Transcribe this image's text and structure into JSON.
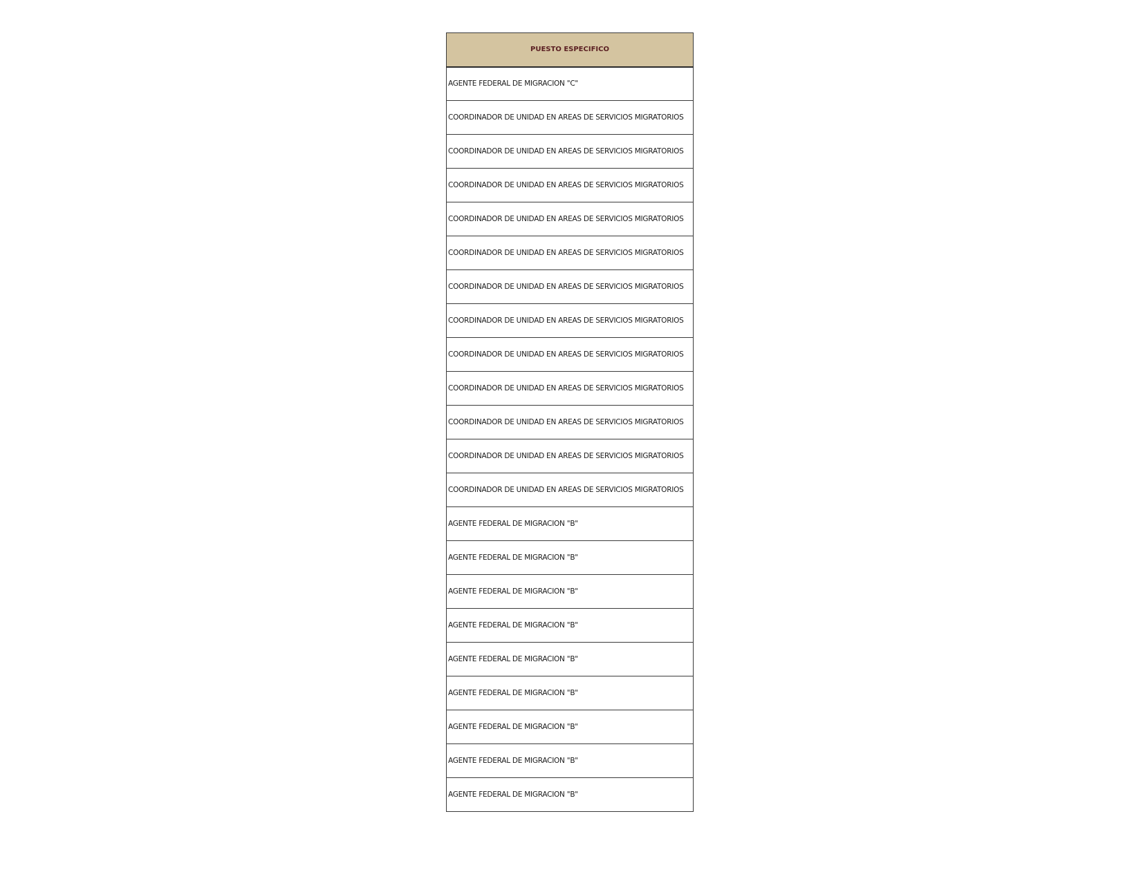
{
  "table": {
    "header": "PUESTO ESPECIFICO",
    "rows": [
      "AGENTE FEDERAL DE MIGRACION \"C\"",
      "COORDINADOR DE UNIDAD EN AREAS DE SERVICIOS MIGRATORIOS",
      "COORDINADOR DE UNIDAD EN AREAS DE SERVICIOS MIGRATORIOS",
      "COORDINADOR DE UNIDAD EN AREAS DE SERVICIOS MIGRATORIOS",
      "COORDINADOR DE UNIDAD EN AREAS DE SERVICIOS MIGRATORIOS",
      "COORDINADOR DE UNIDAD EN AREAS DE SERVICIOS MIGRATORIOS",
      "COORDINADOR DE UNIDAD EN AREAS DE SERVICIOS MIGRATORIOS",
      "COORDINADOR DE UNIDAD EN AREAS DE SERVICIOS MIGRATORIOS",
      "COORDINADOR DE UNIDAD EN AREAS DE SERVICIOS MIGRATORIOS",
      "COORDINADOR DE UNIDAD EN AREAS DE SERVICIOS MIGRATORIOS",
      "COORDINADOR DE UNIDAD EN AREAS DE SERVICIOS MIGRATORIOS",
      "COORDINADOR DE UNIDAD EN AREAS DE SERVICIOS MIGRATORIOS",
      "COORDINADOR DE UNIDAD EN AREAS DE SERVICIOS MIGRATORIOS",
      "AGENTE FEDERAL DE MIGRACION \"B\"",
      "AGENTE FEDERAL DE MIGRACION \"B\"",
      "AGENTE FEDERAL DE MIGRACION \"B\"",
      "AGENTE FEDERAL DE MIGRACION \"B\"",
      "AGENTE FEDERAL DE MIGRACION \"B\"",
      "AGENTE FEDERAL DE MIGRACION \"B\"",
      "AGENTE FEDERAL DE MIGRACION \"B\"",
      "AGENTE FEDERAL DE MIGRACION \"B\"",
      "AGENTE FEDERAL DE MIGRACION \"B\""
    ]
  }
}
